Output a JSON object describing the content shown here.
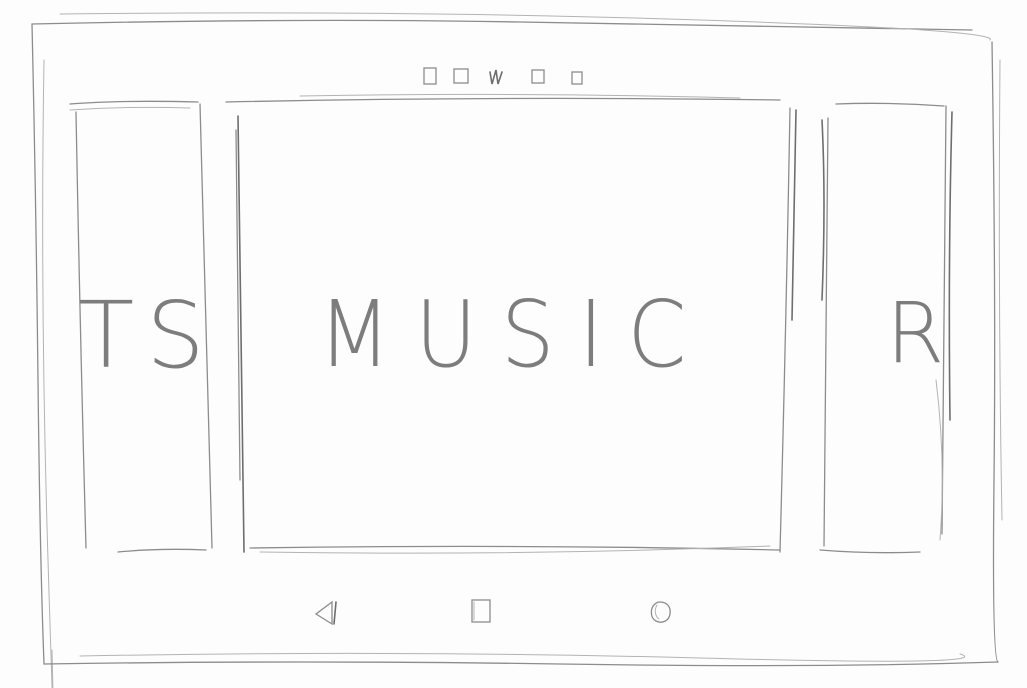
{
  "carousel": {
    "previous_label": "TS",
    "current_label": "MUSIC",
    "next_label": "R"
  },
  "status_bar": {
    "icons": [
      "square-icon",
      "square-icon",
      "signal-icon",
      "square-icon",
      "square-icon"
    ]
  },
  "navigation_bar": {
    "back_icon": "back-triangle-icon",
    "home_icon": "home-square-icon",
    "recent_icon": "circle-icon"
  }
}
